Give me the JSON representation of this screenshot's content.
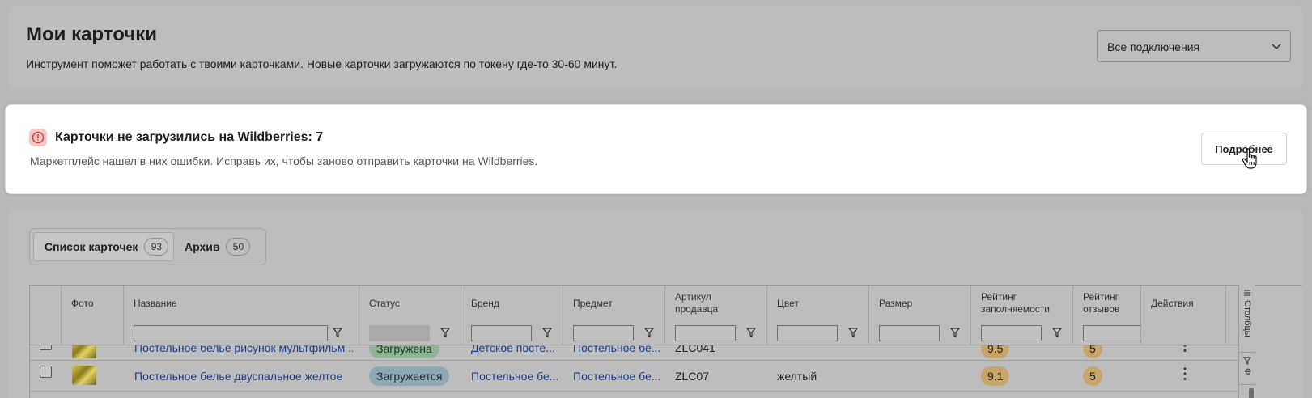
{
  "header": {
    "title": "Мои карточки",
    "subtitle": "Инструмент поможет работать с твоими карточками. Новые карточки загружаются по токену где-то 30-60 минут.",
    "connection_select": {
      "value": "Все подключения"
    }
  },
  "alert": {
    "title": "Карточки не загрузились на Wildberries: 7",
    "text": "Маркетплейс нашел в них ошибки. Исправь их, чтобы заново отправить карточки на Wildberries.",
    "button": "Подробнее"
  },
  "tabs": [
    {
      "label": "Список карточек",
      "count": "93",
      "active": true
    },
    {
      "label": "Архив",
      "count": "50",
      "active": false
    }
  ],
  "table": {
    "columns": {
      "photo": "Фото",
      "name": "Название",
      "status": "Статус",
      "brand": "Бренд",
      "subject": "Предмет",
      "article_1": "Артикул",
      "article_2": "продавца",
      "color": "Цвет",
      "size": "Размер",
      "fill_1": "Рейтинг",
      "fill_2": "заполняемости",
      "reviews_1": "Рейтинг",
      "reviews_2": "отзывов",
      "actions": "Действия"
    },
    "rows": [
      {
        "name": "Постельное белье рисунок мультфильм ...",
        "status": "Загружена",
        "brand": "Детское посте...",
        "subject": "Постельное бе...",
        "article": "ZLC041",
        "color": "",
        "size": "",
        "fill_rating": "9.5",
        "review_rating": "5"
      },
      {
        "name": "Постельное белье двуспальное желтое",
        "status": "Загружается",
        "brand": "Постельное бе...",
        "subject": "Постельное бе...",
        "article": "ZLC07",
        "color": "желтый",
        "size": "",
        "fill_rating": "9.1",
        "review_rating": "5"
      }
    ],
    "side_panel": {
      "columns_tab": "Столбцы",
      "filters_tab": "Ф"
    }
  },
  "icons": {
    "alert": "exclamation-circle-icon",
    "select": "chevron-down-icon",
    "filter": "funnel-icon",
    "menu": "kebab-menu-icon",
    "cursor": "hand-pointer-icon"
  },
  "colors": {
    "alert_icon_bg": "#f6c9c9",
    "alert_icon_fg": "#d23b3b",
    "link": "#1d3e8c",
    "pill_loading": "#8fa8b6",
    "pill_loaded": "#8fb595",
    "score": "#c8a56a"
  }
}
